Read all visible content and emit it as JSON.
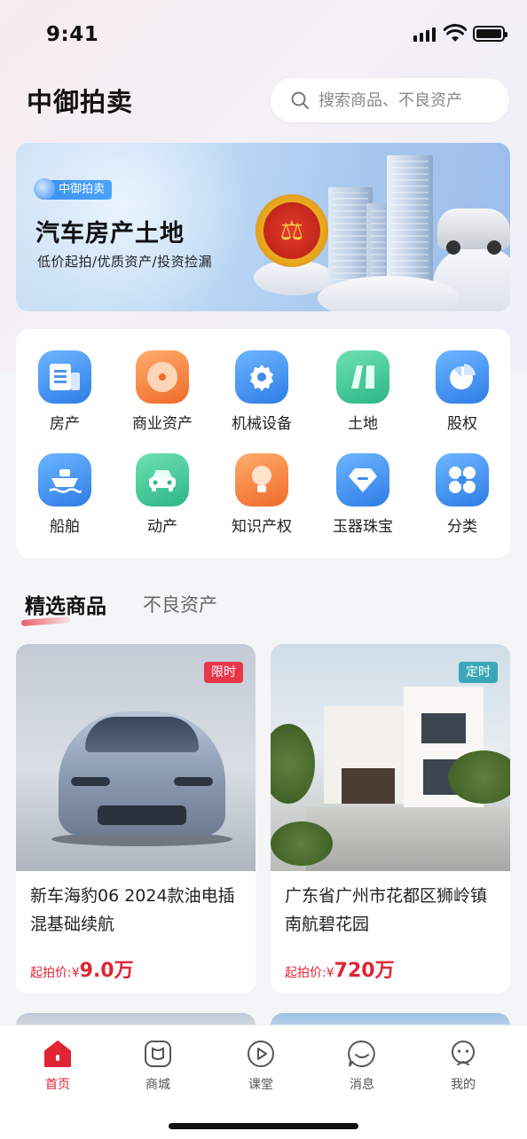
{
  "status_bar": {
    "time": "9:41"
  },
  "header": {
    "title": "中御拍卖",
    "search_placeholder": "搜索商品、不良资产"
  },
  "banner": {
    "tag": "中御拍卖",
    "title": "汽车房产土地",
    "subtitle": "低价起拍/优质资产/投资捡漏",
    "page_count": 4,
    "active_page": 1
  },
  "categories": [
    {
      "label": "房产",
      "icon": "building-icon"
    },
    {
      "label": "商业资产",
      "icon": "target-icon"
    },
    {
      "label": "机械设备",
      "icon": "gear-icon"
    },
    {
      "label": "土地",
      "icon": "land-icon"
    },
    {
      "label": "股权",
      "icon": "pie-chart-icon"
    },
    {
      "label": "船舶",
      "icon": "ship-icon"
    },
    {
      "label": "动产",
      "icon": "car-icon"
    },
    {
      "label": "知识产权",
      "icon": "lightbulb-icon"
    },
    {
      "label": "玉器珠宝",
      "icon": "gem-icon"
    },
    {
      "label": "分类",
      "icon": "grid-icon"
    }
  ],
  "tabs": {
    "selected": "精选商品",
    "other": "不良资产"
  },
  "products": [
    {
      "badge": "限时",
      "badge_color": "#e8364a",
      "name": "新车海豹06 2024款油电插混基础续航",
      "price_label": "起拍价:",
      "price": "¥9.0万",
      "price_currency": "¥",
      "price_value": "9.0万"
    },
    {
      "badge": "定时",
      "badge_color": "#3aa7b8",
      "name": "广东省广州市花都区狮岭镇南航碧花园",
      "price_label": "起拍价:",
      "price": "¥720万",
      "price_currency": "¥",
      "price_value": "720万"
    }
  ],
  "tabbar": [
    {
      "label": "首页",
      "icon": "home-icon",
      "active": true
    },
    {
      "label": "商城",
      "icon": "mall-icon",
      "active": false
    },
    {
      "label": "课堂",
      "icon": "play-icon",
      "active": false
    },
    {
      "label": "消息",
      "icon": "message-icon",
      "active": false
    },
    {
      "label": "我的",
      "icon": "profile-icon",
      "active": false
    }
  ],
  "colors": {
    "accent": "#e02434",
    "tab_active": "#e02434",
    "blue_icon": "#2f7de6",
    "orange_icon": "#ef6b2a",
    "green_icon": "#2cb784"
  }
}
